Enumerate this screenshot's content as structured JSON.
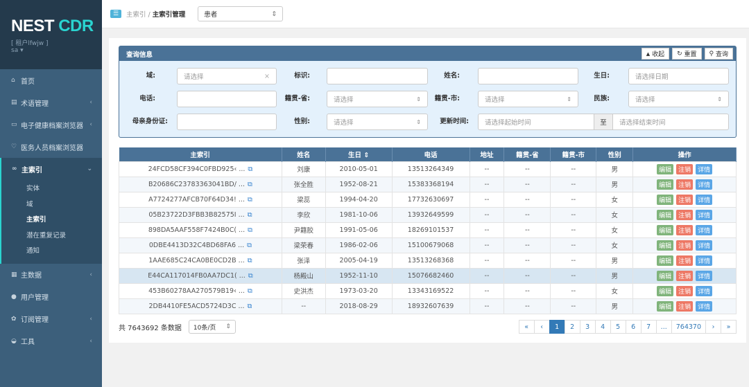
{
  "brand": {
    "name_a": "NEST",
    "name_b": "CDR",
    "tenant": "[ 租户lfwjw ]",
    "user": "sa"
  },
  "sidebar": {
    "items": [
      {
        "label": "首页",
        "icon": "home-icon"
      },
      {
        "label": "术语管理",
        "icon": "list-icon"
      },
      {
        "label": "电子健康档案浏览器",
        "icon": "monitor-icon"
      },
      {
        "label": "医务人员档案浏览器",
        "icon": "stethoscope-icon"
      }
    ],
    "active": {
      "label": "主索引",
      "icon": "link-icon",
      "subs": [
        "实体",
        "域",
        "主索引",
        "潜在重复记录",
        "通知"
      ]
    },
    "bottom": [
      {
        "label": "主数据",
        "icon": "database-icon"
      },
      {
        "label": "用户管理",
        "icon": "user-icon"
      },
      {
        "label": "订阅管理",
        "icon": "gear-icon"
      },
      {
        "label": "工具",
        "icon": "tools-icon"
      }
    ]
  },
  "topbar": {
    "crumb_parent": "主索引",
    "sep": "/",
    "crumb_current": "主索引管理",
    "type_select": "患者"
  },
  "query": {
    "title": "查询信息",
    "collapse": "收起",
    "reset": "重置",
    "search": "查询",
    "labels": {
      "domain": "域:",
      "ident": "标识:",
      "name": "姓名:",
      "birth": "生日:",
      "phone": "电话:",
      "prov": "籍贯-省:",
      "city": "籍贯-市:",
      "ethnic": "民族:",
      "mother_id": "母亲身份证:",
      "gender": "性别:",
      "updated": "更新时间:"
    },
    "placeholders": {
      "select": "请选择",
      "date": "请选择日期",
      "start": "请选择起始时间",
      "end": "请选择结束时间"
    },
    "to": "至"
  },
  "table": {
    "headers": [
      "主索引",
      "姓名",
      "生日 ⇕",
      "电话",
      "地址",
      "籍贯-省",
      "籍贯-市",
      "性别",
      "操作"
    ],
    "actions": [
      "编辑",
      "注销",
      "详情"
    ],
    "rows": [
      [
        "24FCD58CF394C0FBD925‹ ...",
        "刘康",
        "2010-05-01",
        "13513264349",
        "--",
        "--",
        "--",
        "男"
      ],
      [
        "B20686C23783363041BD/ ...",
        "张全胜",
        "1952-08-21",
        "15383368194",
        "--",
        "--",
        "--",
        "男"
      ],
      [
        "A7724277AFCB70F64D34! ...",
        "梁蕊",
        "1994-04-20",
        "17732630697",
        "--",
        "--",
        "--",
        "女"
      ],
      [
        "05B23722D3FBB3B82575I ...",
        "李欣",
        "1981-10-06",
        "13932649599",
        "--",
        "--",
        "--",
        "女"
      ],
      [
        "898DA5AAF558F7424B0C( ...",
        "尹籍胶",
        "1991-05-06",
        "18269101537",
        "--",
        "--",
        "--",
        "女"
      ],
      [
        "0DBE4413D32C4BD68FA6 ...",
        "梁荣春",
        "1986-02-06",
        "15100679068",
        "--",
        "--",
        "--",
        "女"
      ],
      [
        "1AAE685C24CA0BE0CD2B ...",
        "张泽",
        "2005-04-19",
        "13513268368",
        "--",
        "--",
        "--",
        "男"
      ],
      [
        "E44CA117014FB0AA7DC1( ...",
        "杨殿山",
        "1952-11-10",
        "15076682460",
        "--",
        "--",
        "--",
        "男"
      ],
      [
        "453B60278AA270579B19‹ ...",
        "史洪杰",
        "1973-03-20",
        "13343169522",
        "--",
        "--",
        "--",
        "女"
      ],
      [
        "2DB4410FE5ACD5724D3C ...",
        "--",
        "2018-08-29",
        "18932607639",
        "--",
        "--",
        "--",
        "男"
      ]
    ]
  },
  "footer": {
    "total": "共 7643692 条数据",
    "page_size": "10条/页",
    "pages": [
      "«",
      "‹",
      "1",
      "2",
      "3",
      "4",
      "5",
      "6",
      "7",
      "...",
      "764370",
      "›",
      "»"
    ],
    "current": "1"
  }
}
